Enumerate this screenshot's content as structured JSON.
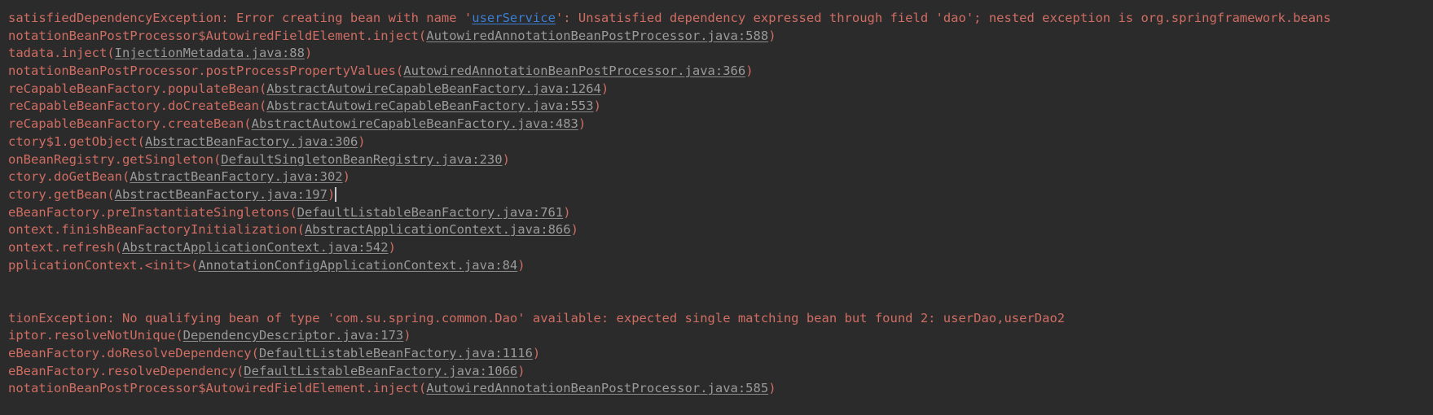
{
  "console": {
    "title": "Exception stacktrace console",
    "background_color": "#2b2b2b",
    "error_text_color": "#cf6a5a",
    "link_color": "#9a9a9a",
    "bean_link_color": "#3a7fd5",
    "caret_color": "#c8c8c8",
    "scrolled_horizontally": true,
    "lines": [
      {
        "id": "line-1",
        "parts": [
          {
            "kind": "error",
            "text": "satisfiedDependencyException: Error creating bean with name "
          },
          {
            "kind": "error",
            "text": "'"
          },
          {
            "kind": "bean-link",
            "text": "userService"
          },
          {
            "kind": "error",
            "text": "': Unsatisfied dependency expressed through field 'dao'; nested exception is org.springframework.beans"
          }
        ]
      },
      {
        "id": "line-2",
        "parts": [
          {
            "kind": "error",
            "text": "notationBeanPostProcessor$AutowiredFieldElement.inject("
          },
          {
            "kind": "file-link",
            "text": "AutowiredAnnotationBeanPostProcessor.java:588"
          },
          {
            "kind": "error",
            "text": ")"
          }
        ]
      },
      {
        "id": "line-3",
        "parts": [
          {
            "kind": "error",
            "text": "tadata.inject("
          },
          {
            "kind": "file-link",
            "text": "InjectionMetadata.java:88"
          },
          {
            "kind": "error",
            "text": ")"
          }
        ]
      },
      {
        "id": "line-4",
        "parts": [
          {
            "kind": "error",
            "text": "notationBeanPostProcessor.postProcessPropertyValues("
          },
          {
            "kind": "file-link",
            "text": "AutowiredAnnotationBeanPostProcessor.java:366"
          },
          {
            "kind": "error",
            "text": ")"
          }
        ]
      },
      {
        "id": "line-5",
        "parts": [
          {
            "kind": "error",
            "text": "reCapableBeanFactory.populateBean("
          },
          {
            "kind": "file-link",
            "text": "AbstractAutowireCapableBeanFactory.java:1264"
          },
          {
            "kind": "error",
            "text": ")"
          }
        ]
      },
      {
        "id": "line-6",
        "parts": [
          {
            "kind": "error",
            "text": "reCapableBeanFactory.doCreateBean("
          },
          {
            "kind": "file-link",
            "text": "AbstractAutowireCapableBeanFactory.java:553"
          },
          {
            "kind": "error",
            "text": ")"
          }
        ]
      },
      {
        "id": "line-7",
        "parts": [
          {
            "kind": "error",
            "text": "reCapableBeanFactory.createBean("
          },
          {
            "kind": "file-link",
            "text": "AbstractAutowireCapableBeanFactory.java:483"
          },
          {
            "kind": "error",
            "text": ")"
          }
        ]
      },
      {
        "id": "line-8",
        "parts": [
          {
            "kind": "error",
            "text": "ctory$1.getObject("
          },
          {
            "kind": "file-link",
            "text": "AbstractBeanFactory.java:306"
          },
          {
            "kind": "error",
            "text": ")"
          }
        ]
      },
      {
        "id": "line-9",
        "parts": [
          {
            "kind": "error",
            "text": "onBeanRegistry.getSingleton("
          },
          {
            "kind": "file-link",
            "text": "DefaultSingletonBeanRegistry.java:230"
          },
          {
            "kind": "error",
            "text": ")"
          }
        ]
      },
      {
        "id": "line-10",
        "parts": [
          {
            "kind": "error",
            "text": "ctory.doGetBean("
          },
          {
            "kind": "file-link",
            "text": "AbstractBeanFactory.java:302"
          },
          {
            "kind": "error",
            "text": ")"
          }
        ]
      },
      {
        "id": "line-11",
        "caret": true,
        "parts": [
          {
            "kind": "error",
            "text": "ctory.getBean("
          },
          {
            "kind": "file-link",
            "text": "AbstractBeanFactory.java:197"
          },
          {
            "kind": "error",
            "text": ")"
          }
        ]
      },
      {
        "id": "line-12",
        "parts": [
          {
            "kind": "error",
            "text": "eBeanFactory.preInstantiateSingletons("
          },
          {
            "kind": "file-link",
            "text": "DefaultListableBeanFactory.java:761"
          },
          {
            "kind": "error",
            "text": ")"
          }
        ]
      },
      {
        "id": "line-13",
        "parts": [
          {
            "kind": "error",
            "text": "ontext.finishBeanFactoryInitialization("
          },
          {
            "kind": "file-link",
            "text": "AbstractApplicationContext.java:866"
          },
          {
            "kind": "error",
            "text": ")"
          }
        ]
      },
      {
        "id": "line-14",
        "parts": [
          {
            "kind": "error",
            "text": "ontext.refresh("
          },
          {
            "kind": "file-link",
            "text": "AbstractApplicationContext.java:542"
          },
          {
            "kind": "error",
            "text": ")"
          }
        ]
      },
      {
        "id": "line-15",
        "parts": [
          {
            "kind": "error",
            "text": "pplicationContext.<init>("
          },
          {
            "kind": "file-link",
            "text": "AnnotationConfigApplicationContext.java:84"
          },
          {
            "kind": "error",
            "text": ")"
          }
        ]
      },
      {
        "id": "line-16-blank",
        "blank": true
      },
      {
        "id": "line-17-blank",
        "blank": true
      },
      {
        "id": "line-18",
        "parts": [
          {
            "kind": "error",
            "text": "tionException: No qualifying bean of type 'com.su.spring.common.Dao' available: expected single matching bean but found 2: userDao,userDao2"
          }
        ]
      },
      {
        "id": "line-19",
        "parts": [
          {
            "kind": "error",
            "text": "iptor.resolveNotUnique("
          },
          {
            "kind": "file-link",
            "text": "DependencyDescriptor.java:173"
          },
          {
            "kind": "error",
            "text": ")"
          }
        ]
      },
      {
        "id": "line-20",
        "parts": [
          {
            "kind": "error",
            "text": "eBeanFactory.doResolveDependency("
          },
          {
            "kind": "file-link",
            "text": "DefaultListableBeanFactory.java:1116"
          },
          {
            "kind": "error",
            "text": ")"
          }
        ]
      },
      {
        "id": "line-21",
        "parts": [
          {
            "kind": "error",
            "text": "eBeanFactory.resolveDependency("
          },
          {
            "kind": "file-link",
            "text": "DefaultListableBeanFactory.java:1066"
          },
          {
            "kind": "error",
            "text": ")"
          }
        ]
      },
      {
        "id": "line-22",
        "parts": [
          {
            "kind": "error",
            "text": "notationBeanPostProcessor$AutowiredFieldElement.inject("
          },
          {
            "kind": "file-link",
            "text": "AutowiredAnnotationBeanPostProcessor.java:585"
          },
          {
            "kind": "error",
            "text": ")"
          }
        ]
      }
    ]
  }
}
